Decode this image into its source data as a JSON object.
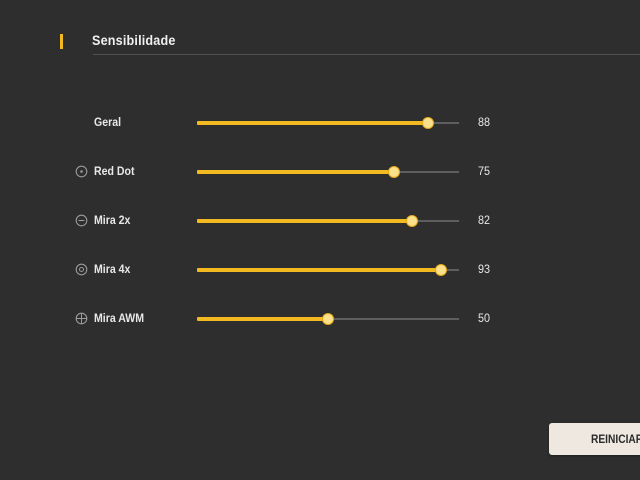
{
  "section": {
    "title": "Sensibilidade"
  },
  "sliders": [
    {
      "label": "Geral",
      "value": 88,
      "icon": "none"
    },
    {
      "label": "Red Dot",
      "value": 75,
      "icon": "red-dot-scope-icon"
    },
    {
      "label": "Mira 2x",
      "value": 82,
      "icon": "scope-2x-icon"
    },
    {
      "label": "Mira 4x",
      "value": 93,
      "icon": "scope-4x-icon"
    },
    {
      "label": "Mira AWM",
      "value": 50,
      "icon": "awm-scope-icon"
    }
  ],
  "slider_max": 100,
  "reset_button": {
    "label": "REINICIAR"
  },
  "colors": {
    "background": "#2e2e2e",
    "accent": "#f2b920",
    "thumb": "#fde08a",
    "track": "#5e5e5e",
    "text": "#e8e8e8",
    "button_bg": "#efe8e1"
  }
}
